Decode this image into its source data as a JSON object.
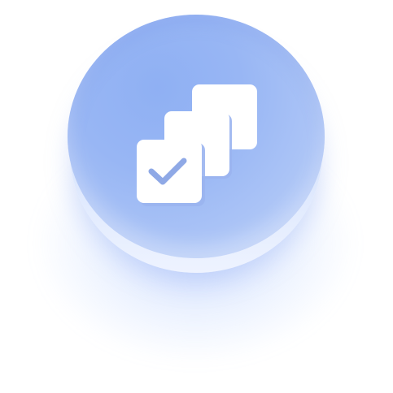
{
  "illustration": {
    "icon": "stacked-checkbox-cards-icon",
    "colors": {
      "disc_top": "#98b6f4",
      "disc_base": "#dce7fd",
      "cards": "#ffffff",
      "checkmark": "#8fa9e6"
    }
  }
}
